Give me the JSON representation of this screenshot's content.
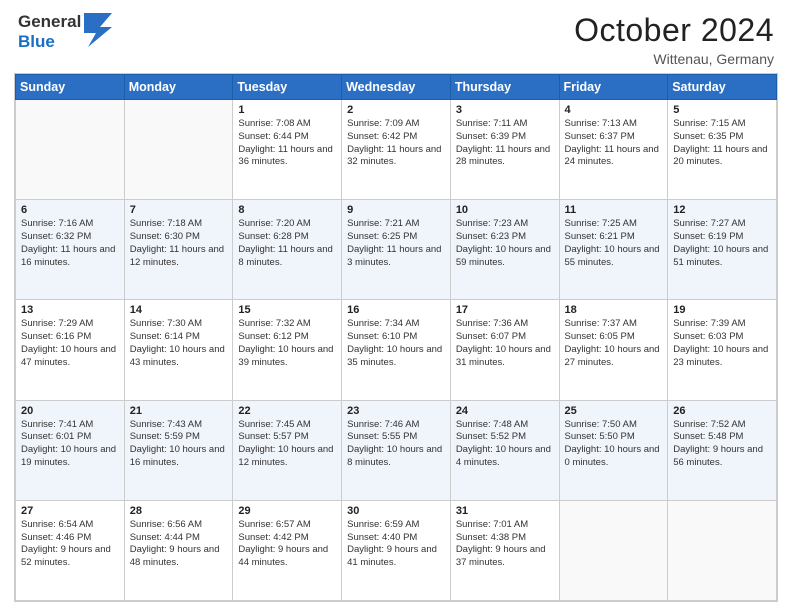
{
  "header": {
    "logo_line1": "General",
    "logo_line2": "Blue",
    "month_year": "October 2024",
    "location": "Wittenau, Germany"
  },
  "weekdays": [
    "Sunday",
    "Monday",
    "Tuesday",
    "Wednesday",
    "Thursday",
    "Friday",
    "Saturday"
  ],
  "weeks": [
    [
      {
        "day": "",
        "info": ""
      },
      {
        "day": "",
        "info": ""
      },
      {
        "day": "1",
        "info": "Sunrise: 7:08 AM\nSunset: 6:44 PM\nDaylight: 11 hours and 36 minutes."
      },
      {
        "day": "2",
        "info": "Sunrise: 7:09 AM\nSunset: 6:42 PM\nDaylight: 11 hours and 32 minutes."
      },
      {
        "day": "3",
        "info": "Sunrise: 7:11 AM\nSunset: 6:39 PM\nDaylight: 11 hours and 28 minutes."
      },
      {
        "day": "4",
        "info": "Sunrise: 7:13 AM\nSunset: 6:37 PM\nDaylight: 11 hours and 24 minutes."
      },
      {
        "day": "5",
        "info": "Sunrise: 7:15 AM\nSunset: 6:35 PM\nDaylight: 11 hours and 20 minutes."
      }
    ],
    [
      {
        "day": "6",
        "info": "Sunrise: 7:16 AM\nSunset: 6:32 PM\nDaylight: 11 hours and 16 minutes."
      },
      {
        "day": "7",
        "info": "Sunrise: 7:18 AM\nSunset: 6:30 PM\nDaylight: 11 hours and 12 minutes."
      },
      {
        "day": "8",
        "info": "Sunrise: 7:20 AM\nSunset: 6:28 PM\nDaylight: 11 hours and 8 minutes."
      },
      {
        "day": "9",
        "info": "Sunrise: 7:21 AM\nSunset: 6:25 PM\nDaylight: 11 hours and 3 minutes."
      },
      {
        "day": "10",
        "info": "Sunrise: 7:23 AM\nSunset: 6:23 PM\nDaylight: 10 hours and 59 minutes."
      },
      {
        "day": "11",
        "info": "Sunrise: 7:25 AM\nSunset: 6:21 PM\nDaylight: 10 hours and 55 minutes."
      },
      {
        "day": "12",
        "info": "Sunrise: 7:27 AM\nSunset: 6:19 PM\nDaylight: 10 hours and 51 minutes."
      }
    ],
    [
      {
        "day": "13",
        "info": "Sunrise: 7:29 AM\nSunset: 6:16 PM\nDaylight: 10 hours and 47 minutes."
      },
      {
        "day": "14",
        "info": "Sunrise: 7:30 AM\nSunset: 6:14 PM\nDaylight: 10 hours and 43 minutes."
      },
      {
        "day": "15",
        "info": "Sunrise: 7:32 AM\nSunset: 6:12 PM\nDaylight: 10 hours and 39 minutes."
      },
      {
        "day": "16",
        "info": "Sunrise: 7:34 AM\nSunset: 6:10 PM\nDaylight: 10 hours and 35 minutes."
      },
      {
        "day": "17",
        "info": "Sunrise: 7:36 AM\nSunset: 6:07 PM\nDaylight: 10 hours and 31 minutes."
      },
      {
        "day": "18",
        "info": "Sunrise: 7:37 AM\nSunset: 6:05 PM\nDaylight: 10 hours and 27 minutes."
      },
      {
        "day": "19",
        "info": "Sunrise: 7:39 AM\nSunset: 6:03 PM\nDaylight: 10 hours and 23 minutes."
      }
    ],
    [
      {
        "day": "20",
        "info": "Sunrise: 7:41 AM\nSunset: 6:01 PM\nDaylight: 10 hours and 19 minutes."
      },
      {
        "day": "21",
        "info": "Sunrise: 7:43 AM\nSunset: 5:59 PM\nDaylight: 10 hours and 16 minutes."
      },
      {
        "day": "22",
        "info": "Sunrise: 7:45 AM\nSunset: 5:57 PM\nDaylight: 10 hours and 12 minutes."
      },
      {
        "day": "23",
        "info": "Sunrise: 7:46 AM\nSunset: 5:55 PM\nDaylight: 10 hours and 8 minutes."
      },
      {
        "day": "24",
        "info": "Sunrise: 7:48 AM\nSunset: 5:52 PM\nDaylight: 10 hours and 4 minutes."
      },
      {
        "day": "25",
        "info": "Sunrise: 7:50 AM\nSunset: 5:50 PM\nDaylight: 10 hours and 0 minutes."
      },
      {
        "day": "26",
        "info": "Sunrise: 7:52 AM\nSunset: 5:48 PM\nDaylight: 9 hours and 56 minutes."
      }
    ],
    [
      {
        "day": "27",
        "info": "Sunrise: 6:54 AM\nSunset: 4:46 PM\nDaylight: 9 hours and 52 minutes."
      },
      {
        "day": "28",
        "info": "Sunrise: 6:56 AM\nSunset: 4:44 PM\nDaylight: 9 hours and 48 minutes."
      },
      {
        "day": "29",
        "info": "Sunrise: 6:57 AM\nSunset: 4:42 PM\nDaylight: 9 hours and 44 minutes."
      },
      {
        "day": "30",
        "info": "Sunrise: 6:59 AM\nSunset: 4:40 PM\nDaylight: 9 hours and 41 minutes."
      },
      {
        "day": "31",
        "info": "Sunrise: 7:01 AM\nSunset: 4:38 PM\nDaylight: 9 hours and 37 minutes."
      },
      {
        "day": "",
        "info": ""
      },
      {
        "day": "",
        "info": ""
      }
    ]
  ]
}
